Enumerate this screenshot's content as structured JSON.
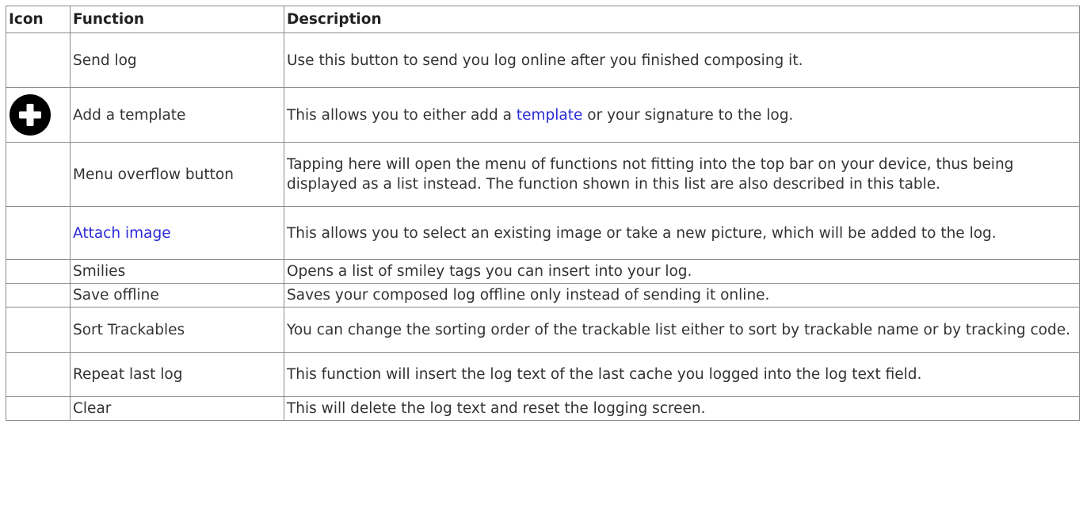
{
  "headers": {
    "icon": "Icon",
    "function": "Function",
    "description": "Description"
  },
  "rows": [
    {
      "icon": "",
      "function": "Send log",
      "description": "Use this button to send you log online after you finished composing it."
    },
    {
      "icon": "add-circle-icon",
      "function": "Add a template",
      "description_before": "This allows you to either add a ",
      "description_link": "template",
      "description_after": " or your signature to the log."
    },
    {
      "icon": "",
      "function": "Menu overflow button",
      "description": "Tapping here will open the menu of functions not fitting into the top bar on your device, thus being displayed as a list instead. The function shown in this list are also described in this table."
    },
    {
      "icon": "",
      "function": "Attach image",
      "function_is_link": true,
      "description": "This allows you to select an existing image or take a new picture, which will be added to the log."
    },
    {
      "icon": "",
      "function": "Smilies",
      "description": "Opens a list of smiley tags you can insert into your log."
    },
    {
      "icon": "",
      "function": "Save offline",
      "description": "Saves your composed log offline only instead of sending it online."
    },
    {
      "icon": "",
      "function": "Sort Trackables",
      "description": "You can change the sorting order of the trackable list either to sort by trackable name or by tracking code."
    },
    {
      "icon": "",
      "function": "Repeat last log",
      "description": "This function will insert the log text of the last cache you logged into the log text field."
    },
    {
      "icon": "",
      "function": "Clear",
      "description": "This will delete the log text and reset the logging screen."
    }
  ],
  "colors": {
    "link": "#2b2bd8",
    "border": "#8c8c8c",
    "text": "#333333"
  }
}
